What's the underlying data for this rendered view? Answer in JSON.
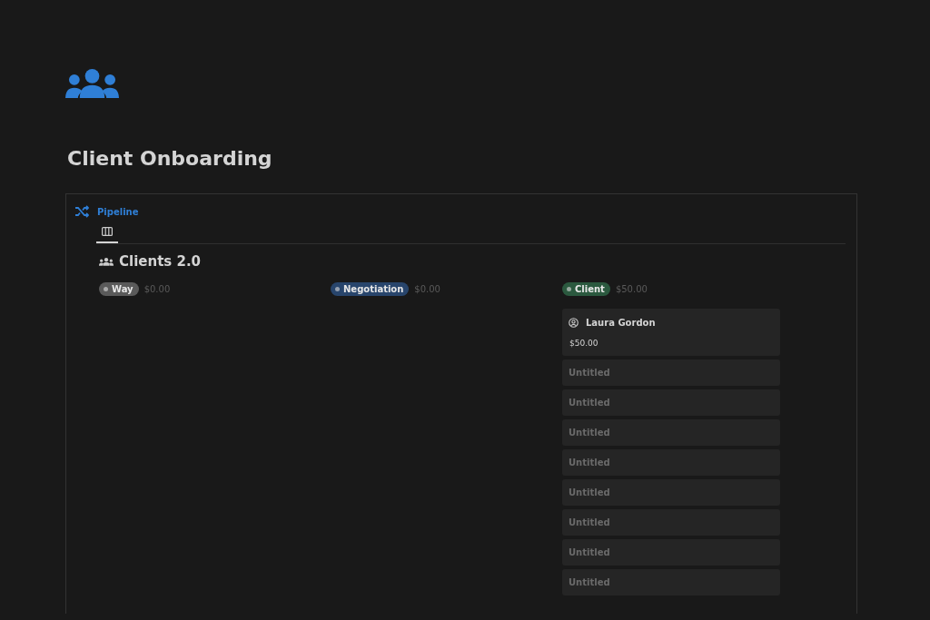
{
  "page": {
    "title": "Client Onboarding"
  },
  "database": {
    "section_title": "Pipeline",
    "view_tab": {
      "selected": true
    },
    "title": "Clients 2.0",
    "groups": [
      {
        "label": "Way",
        "total": "$0.00",
        "color": "#5a5a5a"
      },
      {
        "label": "Negotiation",
        "total": "$0.00",
        "color": "#28456c"
      },
      {
        "label": "Client",
        "total": "$50.00",
        "color": "#2b593f",
        "cards": [
          {
            "kind": "person",
            "title": "Laura Gordon",
            "amount": "$50.00"
          },
          {
            "kind": "untitled",
            "title": "Untitled"
          },
          {
            "kind": "untitled",
            "title": "Untitled"
          },
          {
            "kind": "untitled",
            "title": "Untitled"
          },
          {
            "kind": "untitled",
            "title": "Untitled"
          },
          {
            "kind": "untitled",
            "title": "Untitled"
          },
          {
            "kind": "untitled",
            "title": "Untitled"
          },
          {
            "kind": "untitled",
            "title": "Untitled"
          },
          {
            "kind": "untitled",
            "title": "Untitled"
          }
        ]
      }
    ]
  }
}
